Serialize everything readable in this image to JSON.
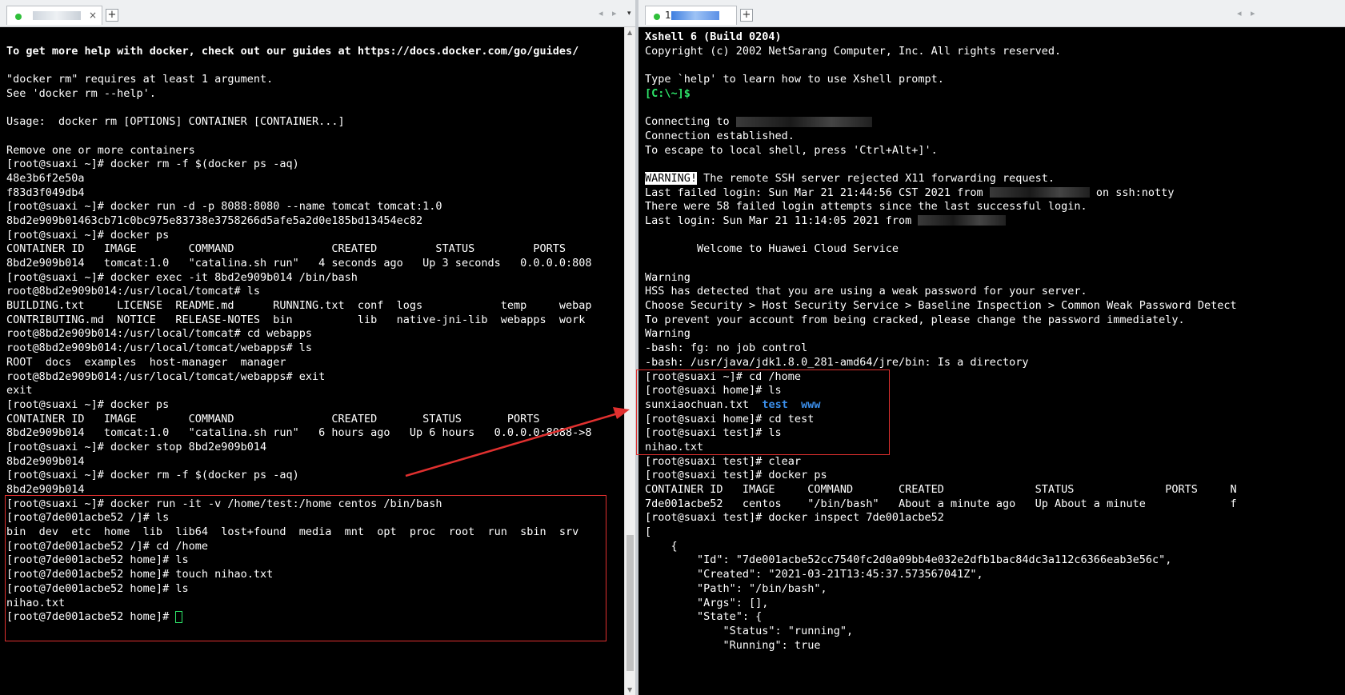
{
  "left": {
    "tab": {
      "title": "",
      "close": "×",
      "new_tab": "+"
    },
    "nav_arrows": "◂ ▸",
    "menu_arrow": "▾",
    "lines": [
      "",
      "To get more help with docker, check out our guides at https://docs.docker.com/go/guides/",
      "",
      "\"docker rm\" requires at least 1 argument.",
      "See 'docker rm --help'.",
      "",
      "Usage:  docker rm [OPTIONS] CONTAINER [CONTAINER...]",
      "",
      "Remove one or more containers",
      "[root@suaxi ~]# docker rm -f $(docker ps -aq)",
      "48e3b6f2e50a",
      "f83d3f049db4",
      "[root@suaxi ~]# docker run -d -p 8088:8080 --name tomcat tomcat:1.0",
      "8bd2e909b01463cb71c0bc975e83738e3758266d5afe5a2d0e185bd13454ec82",
      "[root@suaxi ~]# docker ps",
      "CONTAINER ID   IMAGE        COMMAND               CREATED         STATUS         PORTS",
      "8bd2e909b014   tomcat:1.0   \"catalina.sh run\"   4 seconds ago   Up 3 seconds   0.0.0.0:808",
      "[root@suaxi ~]# docker exec -it 8bd2e909b014 /bin/bash",
      "root@8bd2e909b014:/usr/local/tomcat# ls",
      "BUILDING.txt     LICENSE  README.md      RUNNING.txt  conf  logs            temp     webap",
      "CONTRIBUTING.md  NOTICE   RELEASE-NOTES  bin          lib   native-jni-lib  webapps  work",
      "root@8bd2e909b014:/usr/local/tomcat# cd webapps",
      "root@8bd2e909b014:/usr/local/tomcat/webapps# ls",
      "ROOT  docs  examples  host-manager  manager",
      "root@8bd2e909b014:/usr/local/tomcat/webapps# exit",
      "exit",
      "[root@suaxi ~]# docker ps",
      "CONTAINER ID   IMAGE        COMMAND               CREATED       STATUS       PORTS",
      "8bd2e909b014   tomcat:1.0   \"catalina.sh run\"   6 hours ago   Up 6 hours   0.0.0.0:8088->8",
      "[root@suaxi ~]# docker stop 8bd2e909b014",
      "8bd2e909b014",
      "[root@suaxi ~]# docker rm -f $(docker ps -aq)",
      "8bd2e909b014",
      "[root@suaxi ~]# docker run -it -v /home/test:/home centos /bin/bash",
      "[root@7de001acbe52 /]# ls",
      "bin  dev  etc  home  lib  lib64  lost+found  media  mnt  opt  proc  root  run  sbin  srv",
      "[root@7de001acbe52 /]# cd /home",
      "[root@7de001acbe52 home]# ls",
      "[root@7de001acbe52 home]# touch nihao.txt",
      "[root@7de001acbe52 home]# ls",
      "nihao.txt",
      "[root@7de001acbe52 home]# "
    ]
  },
  "right": {
    "tab": {
      "title": "1",
      "new_tab": "+"
    },
    "nav_arrows": "◂ ▸",
    "lines": [
      "Xshell 6 (Build 0204)",
      "Copyright (c) 2002 NetSarang Computer, Inc. All rights reserved.",
      "",
      "Type `help' to learn how to use Xshell prompt.",
      "[C:\\~]$",
      "",
      "Connecting to ",
      "Connection established.",
      "To escape to local shell, press 'Ctrl+Alt+]'.",
      "",
      "WARNING!",
      "Last failed login: Sun Mar 21 21:44:56 CST 2021 from ",
      "There were 58 failed login attempts since the last successful login.",
      "Last login: Sun Mar 21 11:14:05 2021 from ",
      "",
      "        Welcome to Huawei Cloud Service",
      "",
      "Warning",
      "HSS has detected that you are using a weak password for your server.",
      "Choose Security > Host Security Service > Baseline Inspection > Common Weak Password Detect",
      "To prevent your account from being cracked, please change the password immediately.",
      "Warning",
      "-bash: fg: no job control",
      "-bash: /usr/java/jdk1.8.0_281-amd64/jre/bin: Is a directory",
      "[root@suaxi ~]# cd /home",
      "[root@suaxi home]# ls",
      "sunxiaochuan.txt",
      "[root@suaxi home]# cd test",
      "[root@suaxi test]# ls",
      "nihao.txt",
      "[root@suaxi test]# clear",
      "[root@suaxi test]# docker ps",
      "CONTAINER ID   IMAGE     COMMAND       CREATED              STATUS              PORTS     N",
      "7de001acbe52   centos    \"/bin/bash\"   About a minute ago   Up About a minute             f",
      "[root@suaxi test]# docker inspect 7de001acbe52",
      "[",
      "    {",
      "        \"Id\": \"7de001acbe52cc7540fc2d0a09bb4e032e2dfb1bac84dc3a112c6366eab3e56c\",",
      "        \"Created\": \"2021-03-21T13:45:37.573567041Z\",",
      "        \"Path\": \"/bin/bash\",",
      "        \"Args\": [],",
      "        \"State\": {",
      "            \"Status\": \"running\",",
      "            \"Running\": true"
    ],
    "warning_rest": " The remote SSH server rejected X11 forwarding request.",
    "failed_login_suffix": "on ssh:notty",
    "dir_test": "test",
    "dir_www": "www"
  },
  "colors": {
    "terminal_bg": "#000000",
    "terminal_fg": "#ffffff",
    "prompt_green": "#2ee66a",
    "dir_blue": "#3b8eea",
    "annotation_red": "#e0302f"
  }
}
